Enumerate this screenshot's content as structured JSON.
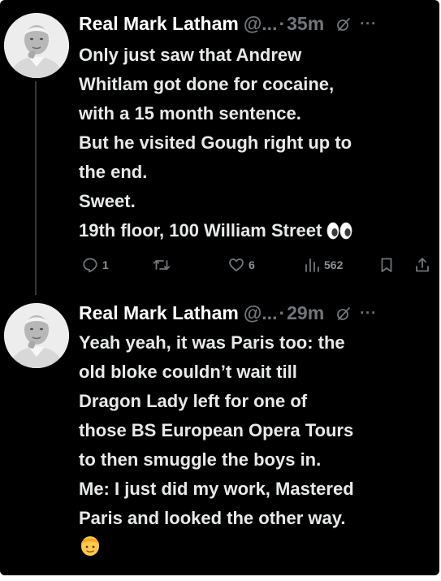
{
  "tweets": [
    {
      "name": "Real Mark Latham",
      "handle": "@...",
      "separator": "·",
      "time": "35m",
      "more": "···",
      "lines": [
        "Only just saw that Andrew",
        "Whitlam got done for cocaine,",
        "with a 15 month sentence.",
        "But he visited Gough right up to",
        "the end.",
        "Sweet.",
        "19th floor, 100 William Street"
      ],
      "emoji": "eyes",
      "actions": {
        "replies": "1",
        "reposts": "",
        "likes": "6",
        "views": "562"
      }
    },
    {
      "name": "Real Mark Latham",
      "handle": "@...",
      "separator": "·",
      "time": "29m",
      "more": "···",
      "lines": [
        "Yeah yeah, it was Paris too: the",
        "old bloke couldn’t wait till",
        "Dragon Lady left for one of",
        "those BS European Opera Tours",
        "to then smuggle the boys in.",
        "Me: I just did my work, Mastered",
        "Paris and looked the other way."
      ],
      "emoji": "man-blond-face"
    }
  ],
  "icons": {
    "avatar": "profile-photo",
    "grok": "grok-icon",
    "reply": "reply-icon",
    "repost": "repost-icon",
    "like": "heart-icon",
    "views": "analytics-icon",
    "bookmark": "bookmark-icon",
    "share": "share-icon"
  },
  "colors": {
    "background": "#000000",
    "text": "#e7e9ea",
    "secondary": "#71767b",
    "thread_line": "#333639"
  }
}
